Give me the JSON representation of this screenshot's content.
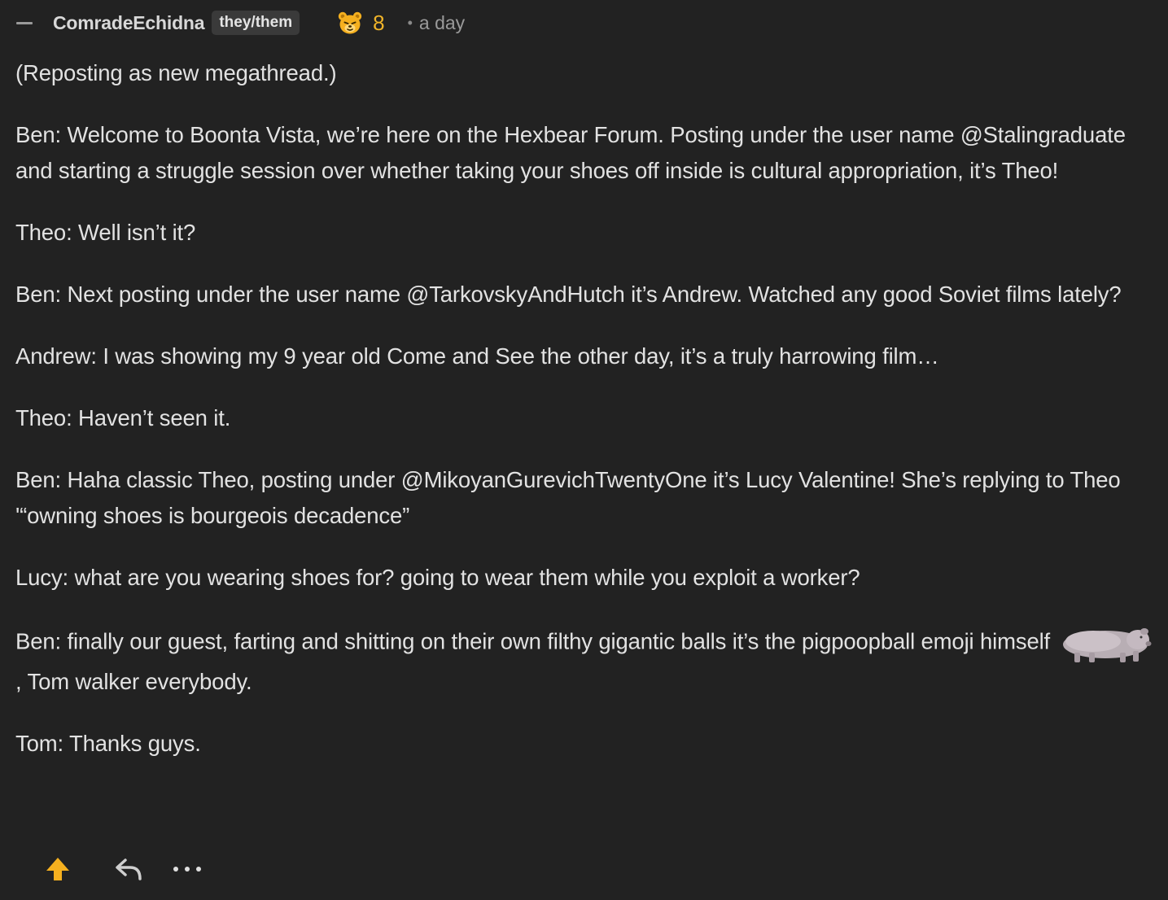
{
  "comment": {
    "username": "ComradeEchidna",
    "pronouns": "they/them",
    "score": "8",
    "score_icon": "bear-icon",
    "time_separator": "•",
    "time": "a day",
    "paragraphs": [
      "(Reposting as new megathread.)",
      "Ben: Welcome to Boonta Vista, we’re here on the Hexbear Forum. Posting under the user name @Stalingraduate and starting a struggle session over whether taking your shoes off inside is cultural appropriation, it’s Theo!",
      "Theo: Well isn’t it?",
      "Ben: Next posting under the user name @TarkovskyAndHutch it’s Andrew. Watched any good Soviet films lately?",
      "Andrew: I was showing my 9 year old Come and See the other day, it’s a truly harrowing film…",
      "Theo: Haven’t seen it.",
      "Ben: Haha classic Theo, posting under @MikoyanGurevichTwentyOne it’s Lucy Valentine! She’s replying to Theo '“owning shoes is bourgeois decadence”",
      "Lucy: what are you wearing shoes for? going to wear them while you exploit a worker?"
    ],
    "emoji_paragraph": {
      "before": "Ben: finally our guest, farting and shitting on their own filthy gigantic balls it’s the pigpoopball emoji himself",
      "emoji": "pigpoopball-emoji",
      "after": ", Tom walker everybody."
    },
    "last_paragraph": "Tom: Thanks guys."
  },
  "actions": {
    "upvote_icon": "upvote-arrow-icon",
    "reply_icon": "reply-icon",
    "more_icon": "more-options-icon"
  },
  "colors": {
    "background": "#222222",
    "text": "#e2e2e2",
    "score": "#f0b429",
    "upvote": "#f5b01f",
    "muted": "#9a9a9a"
  }
}
